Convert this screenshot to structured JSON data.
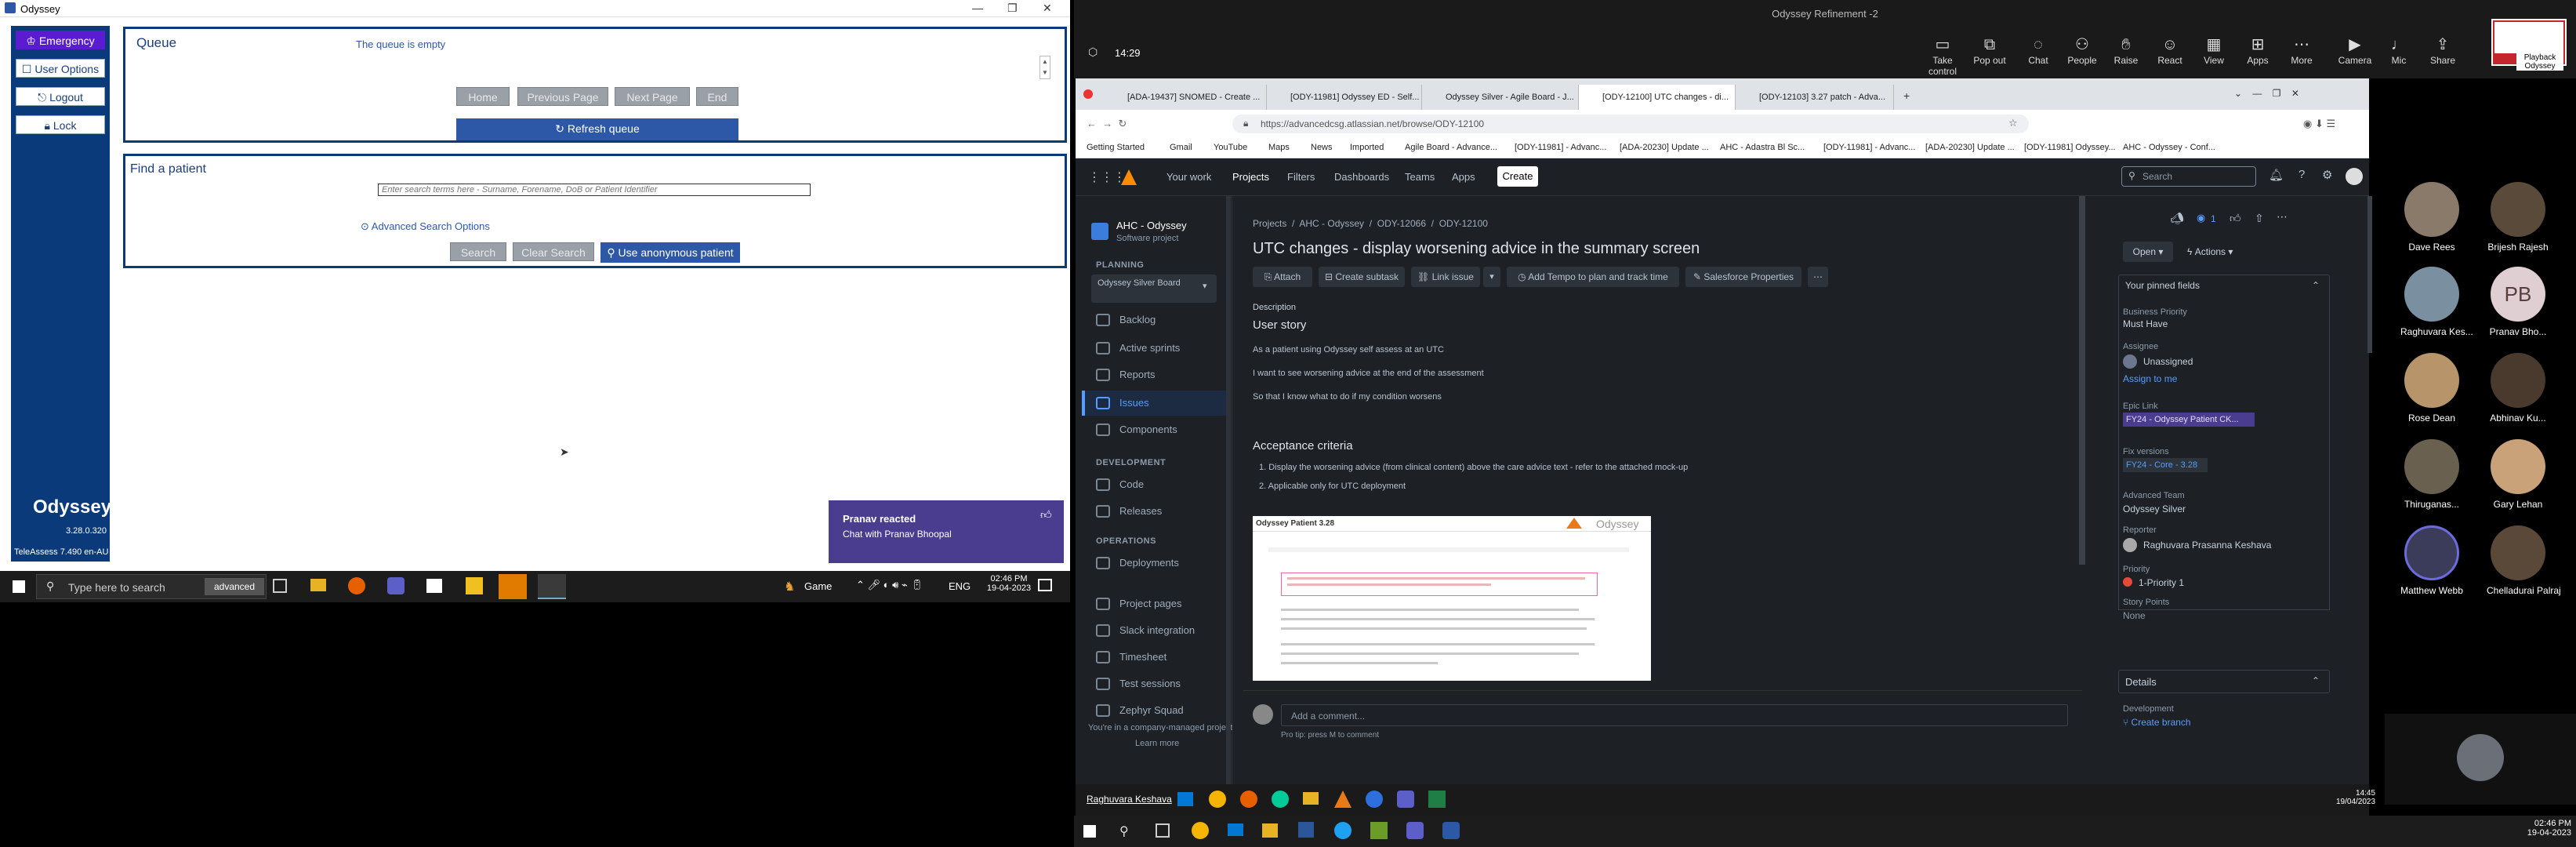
{
  "left_window": {
    "title": "Odyssey",
    "controls": {
      "min": "—",
      "max": "❐",
      "close": "✕"
    },
    "sidebar": {
      "emergency": "Emergency",
      "user_options": "User Options",
      "logout": "Logout",
      "lock": "Lock",
      "app_name": "Odyssey",
      "version": "3.28.0.320",
      "teleassess": "TeleAssess 7.490 en-AU"
    },
    "queue": {
      "title": "Queue",
      "empty": "The queue is empty",
      "home": "Home",
      "previous": "Previous Page",
      "next": "Next Page",
      "end": "End",
      "refresh": "Refresh queue"
    },
    "find": {
      "title": "Find a patient",
      "placeholder": "Enter search terms here - Surname, Forename, DoB or Patient Identifier",
      "advanced": "Advanced Search Options",
      "search": "Search",
      "clear": "Clear Search",
      "anonymous": "Use anonymous patient"
    },
    "toast": {
      "title": "Pranav reacted",
      "body": "Chat with Pranav Bhoopal"
    }
  },
  "taskbar_left": {
    "search_placeholder": "Type here to search",
    "search_chip": "advanced",
    "game": "Game",
    "lang": "ENG",
    "time": "02:46 PM",
    "date": "19-04-2023"
  },
  "zoom": {
    "meeting_title": "Odyssey Refinement -2",
    "timer": "14:29",
    "buttons": [
      "Take control",
      "Pop out",
      "Chat",
      "People",
      "Raise",
      "React",
      "View",
      "Apps",
      "More",
      "Camera",
      "Mic",
      "Share"
    ],
    "playback_label": "Playback Odyssey"
  },
  "browser": {
    "tabs": [
      "[ADA-19437] SNOMED - Create ...",
      "[ODY-11981] Odyssey ED - Self...",
      "Odyssey Silver - Agile Board - J...",
      "[ODY-12100] UTC changes - di...",
      "[ODY-12103] 3.27 patch - Adva..."
    ],
    "url": "https://advancedcsg.atlassian.net/browse/ODY-12100",
    "bookmarks": [
      "Getting Started",
      "Gmail",
      "YouTube",
      "Maps",
      "News",
      "Imported",
      "Agile Board - Advance...",
      "[ODY-11981] - Advanc...",
      "[ADA-20230] Update ...",
      "AHC - Adastra Bl Sc...",
      "[ODY-11981] - Advanc...",
      "[ADA-20230] Update ...",
      "[ODY-11981] Odyssey...",
      "AHC - Odyssey - Conf..."
    ]
  },
  "jira": {
    "nav": [
      "Your work",
      "Projects",
      "Filters",
      "Dashboards",
      "Teams",
      "Apps"
    ],
    "create": "Create",
    "search_placeholder": "Search",
    "project_name": "AHC - Odyssey",
    "project_type": "Software project",
    "planning": "PLANNING",
    "board": "Odyssey Silver Board",
    "planning_items": [
      "Backlog",
      "Active sprints",
      "Reports",
      "Issues",
      "Components"
    ],
    "development": "DEVELOPMENT",
    "dev_items": [
      "Code",
      "Releases"
    ],
    "operations": "OPERATIONS",
    "ops_items": [
      "Deployments"
    ],
    "other_items": [
      "Project pages",
      "Slack integration",
      "Timesheet",
      "Test sessions",
      "Zephyr Squad"
    ],
    "managed": "You're in a company-managed project",
    "learn_more": "Learn more",
    "breadcrumb": [
      "Projects",
      "AHC - Odyssey",
      "ODY-12066",
      "ODY-12100"
    ],
    "issue_title": "UTC changes - display worsening advice in the summary screen",
    "actions": [
      "Attach",
      "Create subtask",
      "Link issue",
      "Add Tempo to plan and track time",
      "Salesforce Properties"
    ],
    "description_label": "Description",
    "user_story": "User story",
    "story_lines": [
      "As a patient using Odyssey self assess at an UTC",
      "I want to see worsening advice at the end of the assessment",
      "So that I know what to do if my condition worsens"
    ],
    "acceptance": "Acceptance criteria",
    "criteria": [
      "1. Display the worsening advice (from clinical content) above the care advice text - refer to the attached mock-up",
      "2. Applicable only for UTC deployment"
    ],
    "mockup_title": "Odyssey Patient 3.28",
    "mockup_brand": "Odyssey",
    "comment_placeholder": "Add a comment...",
    "pro_tip": "Pro tip: press M to comment",
    "status": "Open",
    "actions_btn": "Actions",
    "watch_count": "1",
    "pinned": "Your pinned fields",
    "fields": [
      {
        "label": "Business Priority",
        "value": "Must Have"
      },
      {
        "label": "Assignee",
        "value": "Unassigned"
      },
      {
        "label": "",
        "value": "Assign to me"
      },
      {
        "label": "Epic Link",
        "value": "FY24 - Odyssey Patient CK..."
      },
      {
        "label": "Fix versions",
        "value": "FY24 - Core - 3.28"
      },
      {
        "label": "Advanced Team",
        "value": "Odyssey Silver"
      },
      {
        "label": "Reporter",
        "value": "Raghuvara Prasanna Keshava"
      },
      {
        "label": "Priority",
        "value": "1-Priority 1"
      },
      {
        "label": "Story Points",
        "value": "None"
      }
    ],
    "details": "Details",
    "development_label": "Development",
    "create_branch": "Create branch"
  },
  "inner_taskbar": {
    "presenter": "Raghuvara Keshava",
    "time": "14:45",
    "date": "19/04/2023"
  },
  "participants": [
    {
      "name": "Dave Rees",
      "initials": ""
    },
    {
      "name": "Brijesh Rajesh",
      "initials": ""
    },
    {
      "name": "Raghuvara Kes...",
      "initials": ""
    },
    {
      "name": "Pranav Bho...",
      "initials": "PB"
    },
    {
      "name": "Rose Dean",
      "initials": ""
    },
    {
      "name": "Abhinav Ku...",
      "initials": ""
    },
    {
      "name": "Thiruganas...",
      "initials": ""
    },
    {
      "name": "Gary Lehan",
      "initials": ""
    },
    {
      "name": "Matthew Webb",
      "initials": ""
    },
    {
      "name": "Chelladurai Palraj",
      "initials": ""
    }
  ],
  "taskbar_right": {
    "time": "02:46 PM",
    "date": "19-04-2023"
  },
  "colors": {
    "odyssey_blue": "#0b3a7a",
    "emergency": "#5b1bd1",
    "jira_bg": "#1d2125",
    "toast": "#4a3d8f"
  }
}
